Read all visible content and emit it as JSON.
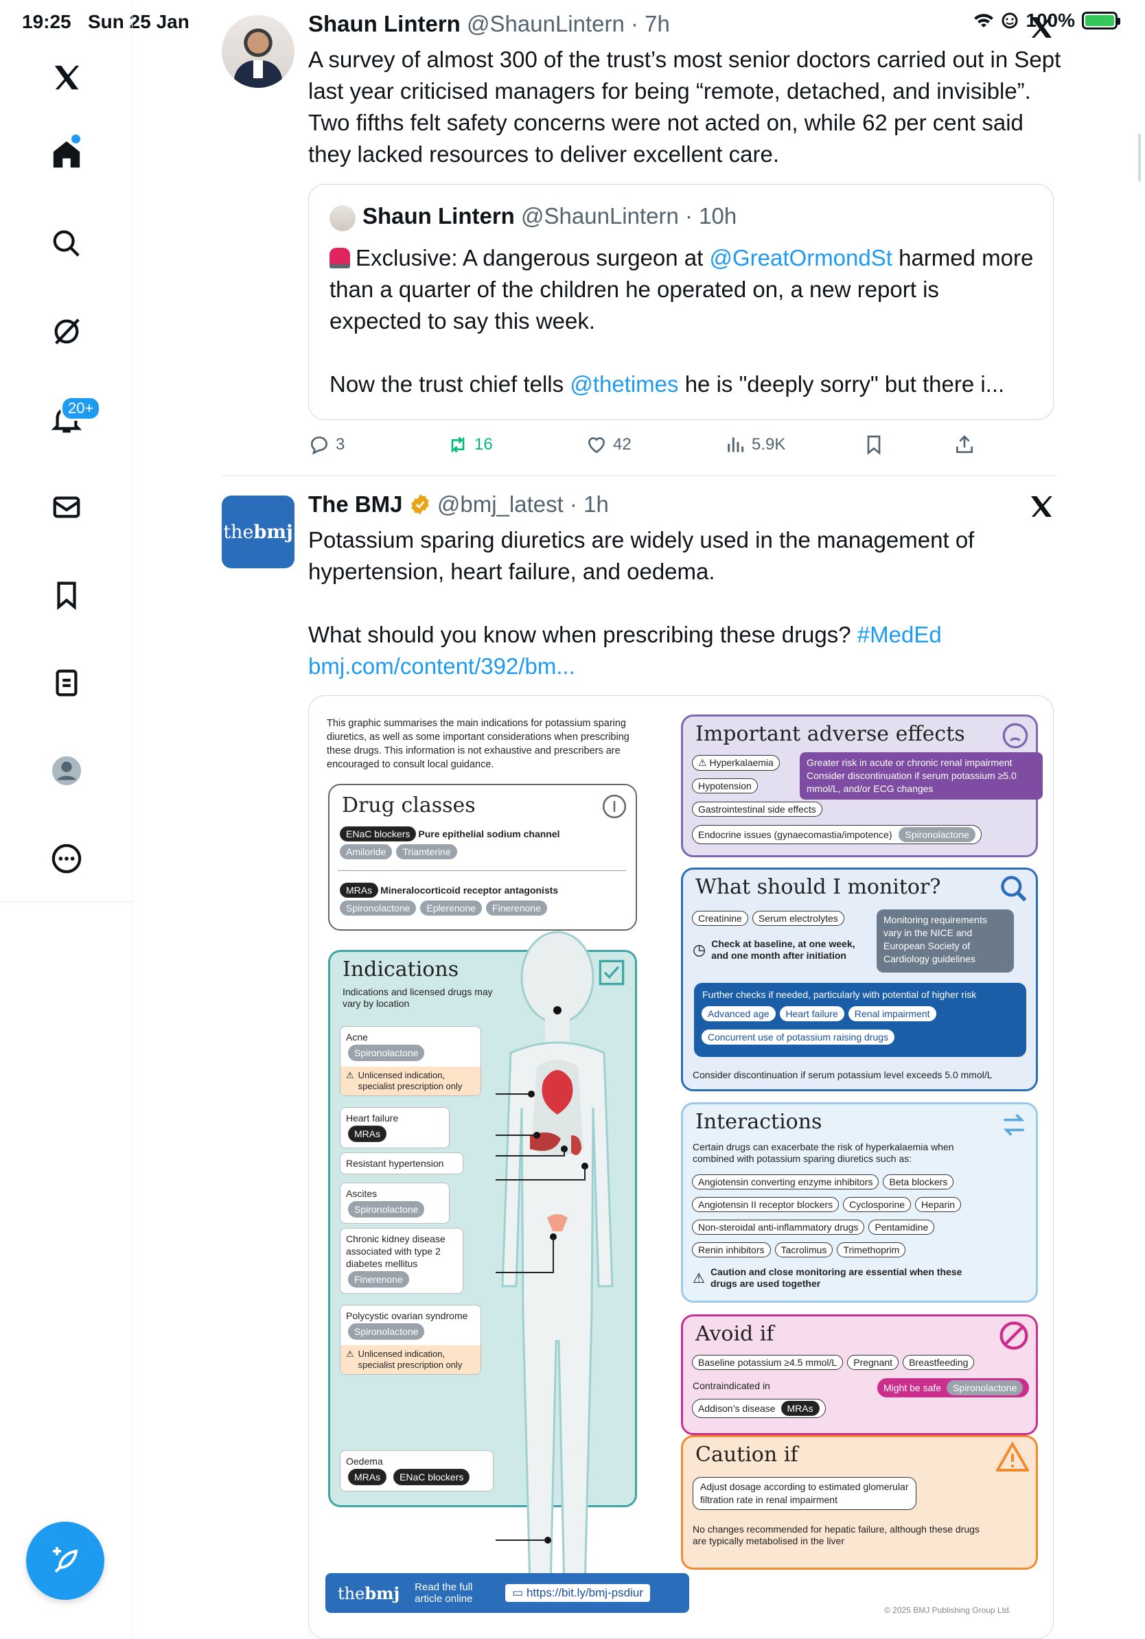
{
  "status_bar": {
    "time": "19:25",
    "date": "Sun 25 Jan",
    "battery": "100%"
  },
  "sidebar": {
    "notifications_badge": "20+",
    "items": [
      "x-logo",
      "home",
      "search",
      "grok",
      "notifications",
      "messages",
      "bookmarks",
      "lists",
      "profile",
      "more"
    ]
  },
  "tweet1": {
    "name": "Shaun Lintern",
    "handle": "@ShaunLintern",
    "time": "7h",
    "text": "A survey of almost 300 of the trust’s most senior doctors carried out in Sept last year criticised managers for being “remote, detached, and invisible”. Two fifths felt safety concerns were not acted on, while 62 per cent said they lacked resources to deliver excellent care.",
    "quote": {
      "name": "Shaun Lintern",
      "handle": "@ShaunLintern",
      "time": "10h",
      "line1_pre": "Exclusive: A dangerous surgeon at ",
      "line1_link": "@GreatOrmondSt",
      "line1_post": " harmed more than a quarter of the children he operated on, a new report is expected to say this week.",
      "line2_pre": "Now the trust chief tells ",
      "line2_link": "@thetimes",
      "line2_post": " he is \"deeply sorry\" but there i..."
    },
    "actions": {
      "replies": "3",
      "reposts": "16",
      "likes": "42",
      "views": "5.9K"
    }
  },
  "tweet2": {
    "name": "The BMJ",
    "handle": "@bmj_latest",
    "time": "1h",
    "avatar_text_a": "the",
    "avatar_text_b": "bmj",
    "para1": "Potassium sparing diuretics are widely used in the management of hypertension, heart failure, and oedema.",
    "para2_pre": "What should you know when prescribing these drugs? ",
    "hashtag": "#MedEd",
    "url": "bmj.com/content/392/bm..."
  },
  "infographic": {
    "intro": "This graphic summarises the main indications for potassium sparing diuretics, as well as some important considerations when prescribing these drugs. This information is not exhaustive and prescribers are encouraged to consult local guidance.",
    "drug_classes": {
      "title": "Drug classes",
      "enac": "ENaC blockers",
      "enac_desc": "Pure epithelial sodium channel",
      "enac_drugs": [
        "Amiloride",
        "Triamterine"
      ],
      "mras": "MRAs",
      "mras_desc": "Mineralocorticoid receptor antagonists",
      "mras_drugs": [
        "Spironolactone",
        "Eplerenone",
        "Finerenone"
      ]
    },
    "indications": {
      "title": "Indications",
      "subtitle": "Indications and licensed drugs may vary by location",
      "acne": "Acne",
      "acne_drug": "Spironolactone",
      "unlicensed": "Unlicensed indication, specialist prescription only",
      "hf": "Heart failure",
      "hf_drug": "MRAs",
      "rh": "Resistant hypertension",
      "ascites": "Ascites",
      "ascites_drug": "Spironolactone",
      "ckd": "Chronic kidney disease associated with type 2 diabetes mellitus",
      "ckd_drug": "Finerenone",
      "pcos": "Polycystic ovarian syndrome",
      "pcos_drug": "Spironolactone",
      "oedema": "Oedema",
      "oedema_drug1": "MRAs",
      "oedema_drug2": "ENaC blockers"
    },
    "adverse": {
      "title": "Important adverse effects",
      "hyperk": "Hyperkalaemia",
      "risk": "Greater risk in acute or chronic renal impairment Consider discontinuation if serum potassium ≥5.0 mmol/L, and/or ECG changes",
      "hypotension": "Hypotension",
      "gi": "Gastrointestinal side effects",
      "endocrine": "Endocrine issues (gynaecomastia/impotence)",
      "endocrine_drug": "Spironolactone"
    },
    "monitor": {
      "title": "What should I monitor?",
      "creatinine": "Creatinine",
      "electrolytes": "Serum electrolytes",
      "note": "Monitoring requirements vary in the NICE and European Society of Cardiology guidelines",
      "check": "Check at baseline, at one week, and one month after initiation",
      "further": "Further checks if needed, particularly with potential of higher risk",
      "risk_items": [
        "Advanced age",
        "Heart failure",
        "Renal impairment",
        "Concurrent use of potassium raising drugs"
      ],
      "discontinue": "Consider discontinuation if serum potassium level exceeds 5.0 mmol/L"
    },
    "interactions": {
      "title": "Interactions",
      "subtitle": "Certain drugs can exacerbate the risk of hyperkalaemia when combined with potassium sparing diuretics such as:",
      "drugs": [
        "Angiotensin converting enzyme inhibitors",
        "Beta blockers",
        "Angiotensin II receptor blockers",
        "Cyclosporine",
        "Heparin",
        "Non-steroidal anti-inflammatory drugs",
        "Pentamidine",
        "Renin inhibitors",
        "Tacrolimus",
        "Trimethoprim"
      ],
      "caution": "Caution and close monitoring are essential when these drugs are used together"
    },
    "avoid": {
      "title": "Avoid if",
      "items": [
        "Baseline potassium ≥4.5 mmol/L",
        "Pregnant",
        "Breastfeeding"
      ],
      "contra": "Contraindicated in",
      "safe": "Might be safe",
      "safe_drug": "Spironolactone",
      "addisons": "Addison’s disease",
      "addisons_drug": "MRAs"
    },
    "caution": {
      "title": "Caution if",
      "dosage": "Adjust dosage according to estimated glomerular filtration rate in renal impairment",
      "hepatic": "No changes recommended for hepatic failure, although these drugs are typically metabolised in the liver"
    },
    "footer": {
      "logo_a": "the",
      "logo_b": "bmj",
      "read": "Read the full article online",
      "url": "https://bit.ly/bmj-psdiur",
      "copyright": "© 2025 BMJ Publishing Group Ltd."
    }
  },
  "colors": {
    "accent": "#1d9bf0",
    "repost": "#00ba7c",
    "bmj_blue": "#2a6ebb"
  }
}
